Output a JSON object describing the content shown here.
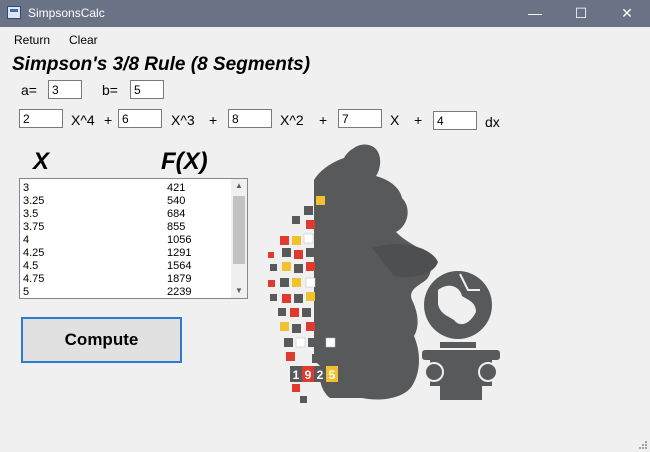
{
  "window": {
    "title": "SimpsonsCalc",
    "icon": "calculator-app-icon",
    "minimize_glyph": "—",
    "maximize_glyph": "☐",
    "close_glyph": "✕"
  },
  "menu": {
    "items": [
      "Return",
      "Clear"
    ]
  },
  "heading": "Simpson's 3/8 Rule (8 Segments)",
  "bounds": {
    "a_label": "a=",
    "a_value": "3",
    "b_label": "b=",
    "b_value": "5"
  },
  "polynomial": {
    "c4": "2",
    "x4_label": "X^4",
    "plus1": "+",
    "c3": "6",
    "x3_label": "X^3",
    "plus2": "+",
    "c2": "8",
    "x2_label": "X^2",
    "plus3": "+",
    "c1": "7",
    "x1_label": "X",
    "plus4": "+",
    "c0": "4",
    "dx_label": "dx"
  },
  "table": {
    "x_header": "X",
    "fx_header": "F(X)",
    "rows": [
      {
        "x": "3",
        "fx": "421"
      },
      {
        "x": "3.25",
        "fx": "540"
      },
      {
        "x": "3.5",
        "fx": "684"
      },
      {
        "x": "3.75",
        "fx": "855"
      },
      {
        "x": "4",
        "fx": "1056"
      },
      {
        "x": "4.25",
        "fx": "1291"
      },
      {
        "x": "4.5",
        "fx": "1564"
      },
      {
        "x": "4.75",
        "fx": "1879"
      },
      {
        "x": "5",
        "fx": "2239"
      }
    ]
  },
  "compute_label": "Compute",
  "logo": {
    "icon": "thinker-globe-logo",
    "year_digits": [
      "1",
      "9",
      "2",
      "5"
    ]
  },
  "colors": {
    "titlebar": "#6a7385",
    "accent_border": "#2b7bcf",
    "logo_grey": "#58595b",
    "logo_red": "#e03a2f",
    "logo_yellow": "#f2c12e"
  }
}
